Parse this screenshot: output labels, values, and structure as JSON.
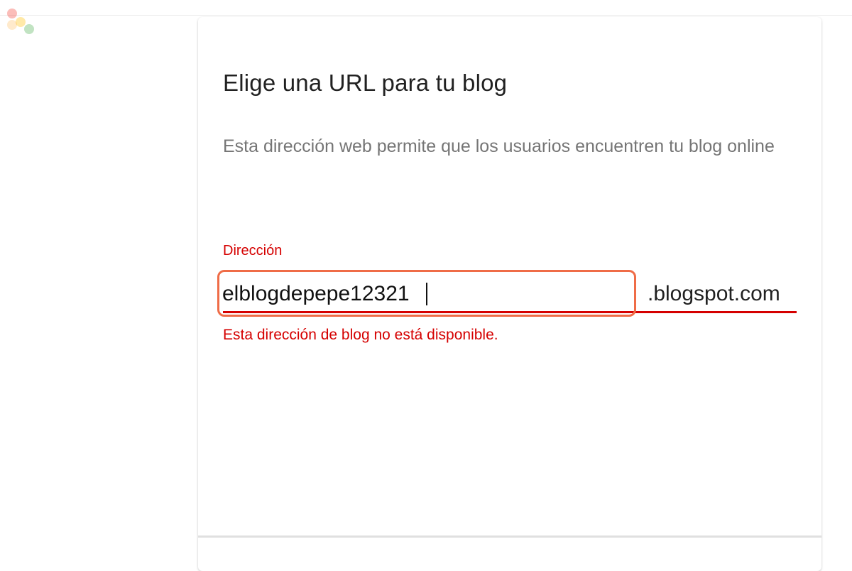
{
  "dialog": {
    "title": "Elige una URL para tu blog",
    "description": "Esta dirección web permite que los usuarios encuentren tu blog online",
    "address_field": {
      "label": "Dirección",
      "value": "elblogdepepe12321",
      "suffix": ".blogspot.com",
      "error": "Esta dirección de blog no está disponible."
    }
  },
  "colors": {
    "error": "#d50000",
    "highlight": "#ef6c47",
    "title": "#212121",
    "description": "#757575"
  }
}
